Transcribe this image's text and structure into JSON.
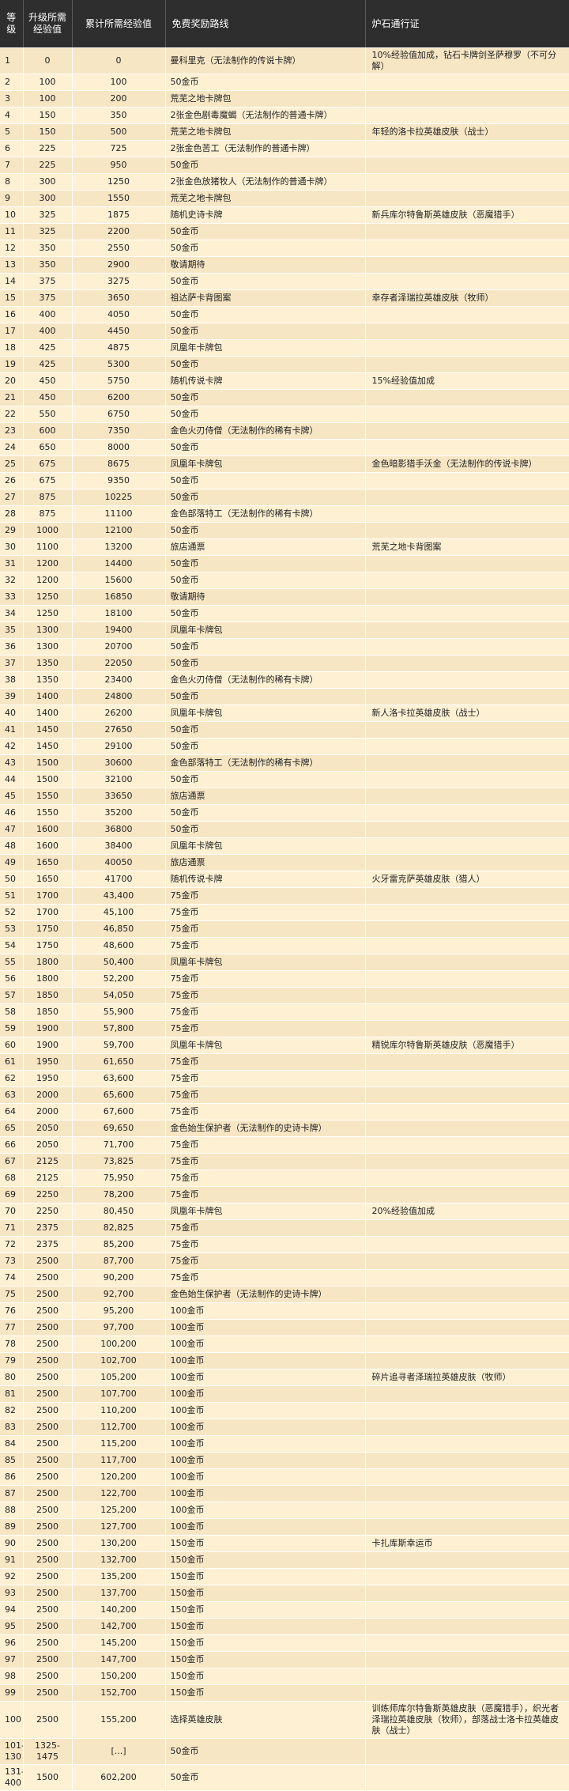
{
  "headers": {
    "level": "等级",
    "required": "升级所需经验值",
    "cumulative": "累计所需经验值",
    "free": "免费奖励路线",
    "pass": "炉石通行证"
  },
  "rows": [
    [
      "1",
      "0",
      "0",
      "曼科里克（无法制作的传说卡牌）",
      "10%经验值加成，钻石卡牌剑圣萨穆罗（不可分解）"
    ],
    [
      "2",
      "100",
      "100",
      "50金币",
      ""
    ],
    [
      "3",
      "100",
      "200",
      "荒芜之地卡牌包",
      ""
    ],
    [
      "4",
      "150",
      "350",
      "2张金色剧毒魔蝎（无法制作的普通卡牌）",
      ""
    ],
    [
      "5",
      "150",
      "500",
      "荒芜之地卡牌包",
      "年轻的洛卡拉英雄皮肤（战士）"
    ],
    [
      "6",
      "225",
      "725",
      "2张金色苦工（无法制作的普通卡牌）",
      ""
    ],
    [
      "7",
      "225",
      "950",
      "50金币",
      ""
    ],
    [
      "8",
      "300",
      "1250",
      "2张金色放猪牧人（无法制作的普通卡牌）",
      ""
    ],
    [
      "9",
      "300",
      "1550",
      "荒芜之地卡牌包",
      ""
    ],
    [
      "10",
      "325",
      "1875",
      "随机史诗卡牌",
      "新兵库尔特鲁斯英雄皮肤（恶魔猎手）"
    ],
    [
      "11",
      "325",
      "2200",
      "50金币",
      ""
    ],
    [
      "12",
      "350",
      "2550",
      "50金币",
      ""
    ],
    [
      "13",
      "350",
      "2900",
      "敬请期待",
      ""
    ],
    [
      "14",
      "375",
      "3275",
      "50金币",
      ""
    ],
    [
      "15",
      "375",
      "3650",
      "祖达萨卡背图案",
      "幸存者泽瑞拉英雄皮肤（牧师）"
    ],
    [
      "16",
      "400",
      "4050",
      "50金币",
      ""
    ],
    [
      "17",
      "400",
      "4450",
      "50金币",
      ""
    ],
    [
      "18",
      "425",
      "4875",
      "凤凰年卡牌包",
      ""
    ],
    [
      "19",
      "425",
      "5300",
      "50金币",
      ""
    ],
    [
      "20",
      "450",
      "5750",
      "随机传说卡牌",
      "15%经验值加成"
    ],
    [
      "21",
      "450",
      "6200",
      "50金币",
      ""
    ],
    [
      "22",
      "550",
      "6750",
      "50金币",
      ""
    ],
    [
      "23",
      "600",
      "7350",
      "金色火刃侍僧（无法制作的稀有卡牌）",
      ""
    ],
    [
      "24",
      "650",
      "8000",
      "50金币",
      ""
    ],
    [
      "25",
      "675",
      "8675",
      "凤凰年卡牌包",
      "金色暗影猎手沃金（无法制作的传说卡牌）"
    ],
    [
      "26",
      "675",
      "9350",
      "50金币",
      ""
    ],
    [
      "27",
      "875",
      "10225",
      "50金币",
      ""
    ],
    [
      "28",
      "875",
      "11100",
      "金色部落特工（无法制作的稀有卡牌）",
      ""
    ],
    [
      "29",
      "1000",
      "12100",
      "50金币",
      ""
    ],
    [
      "30",
      "1100",
      "13200",
      "旅店通票",
      "荒芜之地卡背图案"
    ],
    [
      "31",
      "1200",
      "14400",
      "50金币",
      ""
    ],
    [
      "32",
      "1200",
      "15600",
      "50金币",
      ""
    ],
    [
      "33",
      "1250",
      "16850",
      "敬请期待",
      ""
    ],
    [
      "34",
      "1250",
      "18100",
      "50金币",
      ""
    ],
    [
      "35",
      "1300",
      "19400",
      "凤凰年卡牌包",
      ""
    ],
    [
      "36",
      "1300",
      "20700",
      "50金币",
      ""
    ],
    [
      "37",
      "1350",
      "22050",
      "50金币",
      ""
    ],
    [
      "38",
      "1350",
      "23400",
      "金色火刃侍僧（无法制作的稀有卡牌）",
      ""
    ],
    [
      "39",
      "1400",
      "24800",
      "50金币",
      ""
    ],
    [
      "40",
      "1400",
      "26200",
      "凤凰年卡牌包",
      "新人洛卡拉英雄皮肤（战士）"
    ],
    [
      "41",
      "1450",
      "27650",
      "50金币",
      ""
    ],
    [
      "42",
      "1450",
      "29100",
      "50金币",
      ""
    ],
    [
      "43",
      "1500",
      "30600",
      "金色部落特工（无法制作的稀有卡牌）",
      ""
    ],
    [
      "44",
      "1500",
      "32100",
      "50金币",
      ""
    ],
    [
      "45",
      "1550",
      "33650",
      "旅店通票",
      ""
    ],
    [
      "46",
      "1550",
      "35200",
      "50金币",
      ""
    ],
    [
      "47",
      "1600",
      "36800",
      "50金币",
      ""
    ],
    [
      "48",
      "1600",
      "38400",
      "凤凰年卡牌包",
      ""
    ],
    [
      "49",
      "1650",
      "40050",
      "旅店通票",
      ""
    ],
    [
      "50",
      "1650",
      "41700",
      "随机传说卡牌",
      "火牙雷克萨英雄皮肤（猎人）"
    ],
    [
      "51",
      "1700",
      "43,400",
      "75金币",
      ""
    ],
    [
      "52",
      "1700",
      "45,100",
      "75金币",
      ""
    ],
    [
      "53",
      "1750",
      "46,850",
      "75金币",
      ""
    ],
    [
      "54",
      "1750",
      "48,600",
      "75金币",
      ""
    ],
    [
      "55",
      "1800",
      "50,400",
      "凤凰年卡牌包",
      ""
    ],
    [
      "56",
      "1800",
      "52,200",
      "75金币",
      ""
    ],
    [
      "57",
      "1850",
      "54,050",
      "75金币",
      ""
    ],
    [
      "58",
      "1850",
      "55,900",
      "75金币",
      ""
    ],
    [
      "59",
      "1900",
      "57,800",
      "75金币",
      ""
    ],
    [
      "60",
      "1900",
      "59,700",
      "凤凰年卡牌包",
      "精锐库尔特鲁斯英雄皮肤（恶魔猎手）"
    ],
    [
      "61",
      "1950",
      "61,650",
      "75金币",
      ""
    ],
    [
      "62",
      "1950",
      "63,600",
      "75金币",
      ""
    ],
    [
      "63",
      "2000",
      "65,600",
      "75金币",
      ""
    ],
    [
      "64",
      "2000",
      "67,600",
      "75金币",
      ""
    ],
    [
      "65",
      "2050",
      "69,650",
      "金色始生保护者（无法制作的史诗卡牌）",
      ""
    ],
    [
      "66",
      "2050",
      "71,700",
      "75金币",
      ""
    ],
    [
      "67",
      "2125",
      "73,825",
      "75金币",
      ""
    ],
    [
      "68",
      "2125",
      "75,950",
      "75金币",
      ""
    ],
    [
      "69",
      "2250",
      "78,200",
      "75金币",
      ""
    ],
    [
      "70",
      "2250",
      "80,450",
      "凤凰年卡牌包",
      "20%经验值加成"
    ],
    [
      "71",
      "2375",
      "82,825",
      "75金币",
      ""
    ],
    [
      "72",
      "2375",
      "85,200",
      "75金币",
      ""
    ],
    [
      "73",
      "2500",
      "87,700",
      "75金币",
      ""
    ],
    [
      "74",
      "2500",
      "90,200",
      "75金币",
      ""
    ],
    [
      "75",
      "2500",
      "92,700",
      "金色始生保护者（无法制作的史诗卡牌）",
      ""
    ],
    [
      "76",
      "2500",
      "95,200",
      "100金币",
      ""
    ],
    [
      "77",
      "2500",
      "97,700",
      "100金币",
      ""
    ],
    [
      "78",
      "2500",
      "100,200",
      "100金币",
      ""
    ],
    [
      "79",
      "2500",
      "102,700",
      "100金币",
      ""
    ],
    [
      "80",
      "2500",
      "105,200",
      "100金币",
      "碎片追寻者泽瑞拉英雄皮肤（牧师）"
    ],
    [
      "81",
      "2500",
      "107,700",
      "100金币",
      ""
    ],
    [
      "82",
      "2500",
      "110,200",
      "100金币",
      ""
    ],
    [
      "83",
      "2500",
      "112,700",
      "100金币",
      ""
    ],
    [
      "84",
      "2500",
      "115,200",
      "100金币",
      ""
    ],
    [
      "85",
      "2500",
      "117,700",
      "100金币",
      ""
    ],
    [
      "86",
      "2500",
      "120,200",
      "100金币",
      ""
    ],
    [
      "87",
      "2500",
      "122,700",
      "100金币",
      ""
    ],
    [
      "88",
      "2500",
      "125,200",
      "100金币",
      ""
    ],
    [
      "89",
      "2500",
      "127,700",
      "100金币",
      ""
    ],
    [
      "90",
      "2500",
      "130,200",
      "150金币",
      "卡扎库斯幸运币"
    ],
    [
      "91",
      "2500",
      "132,700",
      "150金币",
      ""
    ],
    [
      "92",
      "2500",
      "135,200",
      "150金币",
      ""
    ],
    [
      "93",
      "2500",
      "137,700",
      "150金币",
      ""
    ],
    [
      "94",
      "2500",
      "140,200",
      "150金币",
      ""
    ],
    [
      "95",
      "2500",
      "142,700",
      "150金币",
      ""
    ],
    [
      "96",
      "2500",
      "145,200",
      "150金币",
      ""
    ],
    [
      "97",
      "2500",
      "147,700",
      "150金币",
      ""
    ],
    [
      "98",
      "2500",
      "150,200",
      "150金币",
      ""
    ],
    [
      "99",
      "2500",
      "152,700",
      "150金币",
      ""
    ],
    [
      "100",
      "2500",
      "155,200",
      "选择英雄皮肤",
      "训练师库尔特鲁斯英雄皮肤（恶魔猎手），织光者泽瑞拉英雄皮肤（牧师），部落战士洛卡拉英雄皮肤（战士）"
    ],
    [
      "101-130",
      "1325-1475",
      "[...]",
      "50金币",
      ""
    ],
    [
      "131-400",
      "1500",
      "602,200",
      "50金币",
      ""
    ]
  ]
}
